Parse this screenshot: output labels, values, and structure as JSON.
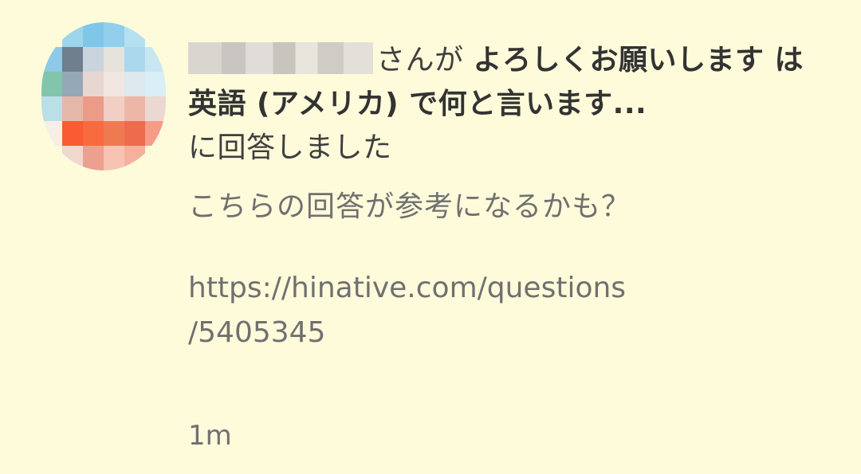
{
  "notification": {
    "username_redacted": true,
    "san_ga": "さんが ",
    "question_title": "よろしくお願いします は 英語 (アメリカ) で何と言います...",
    "action_text": "に回答しました",
    "message": "こちらの回答が参考になるかも？",
    "link_line1": "https://hinative.com/questions",
    "link_line2": "/5405345",
    "timestamp": "1m"
  },
  "avatar": {
    "icon": "user-avatar-pixelated",
    "colors": [
      "#FEFBDB",
      "#9bd6ec",
      "#7cc7ea",
      "#8fd0ee",
      "#b3e0f2",
      "#FEFBDB",
      "#8ccaea",
      "#6e7f8f",
      "#c9d4de",
      "#e6e2dc",
      "#a9d8ee",
      "#c7e6f3",
      "#7fc6ac",
      "#93a8b8",
      "#e8d7cf",
      "#f1e6e0",
      "#dde9ef",
      "#d9eef7",
      "#b9dfe7",
      "#e7b7a7",
      "#ee9a85",
      "#f3cfc4",
      "#f0b5a6",
      "#edd8cf",
      "#f7efe6",
      "#ff5a2c",
      "#ff6a3a",
      "#f4794f",
      "#f46a4a",
      "#fb9a86",
      "#FEFBDB",
      "#f1d8cf",
      "#ef9f8d",
      "#f9c2b1",
      "#f8b09a",
      "#FEFBDB"
    ]
  }
}
